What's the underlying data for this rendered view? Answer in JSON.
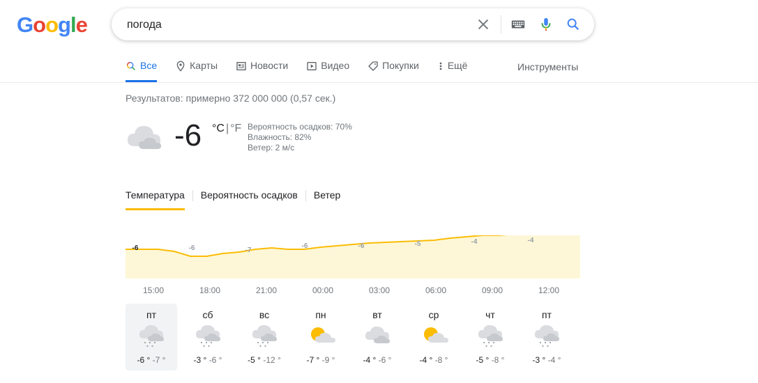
{
  "logo_text": [
    "G",
    "o",
    "o",
    "g",
    "l",
    "e"
  ],
  "logo_colors": [
    "#4285F4",
    "#EA4335",
    "#FBBC05",
    "#4285F4",
    "#34A853",
    "#EA4335"
  ],
  "search": {
    "query": "погода"
  },
  "tabs": [
    {
      "label": "Все",
      "icon": "search-icon",
      "active": true
    },
    {
      "label": "Карты",
      "icon": "map-pin-icon"
    },
    {
      "label": "Новости",
      "icon": "news-icon"
    },
    {
      "label": "Видео",
      "icon": "video-icon"
    },
    {
      "label": "Покупки",
      "icon": "tag-icon"
    },
    {
      "label": "Ещё",
      "icon": "more-vert-icon"
    }
  ],
  "tools_label": "Инструменты",
  "result_stats": "Результатов: примерно 372 000 000 (0,57 сек.)",
  "weather": {
    "current_icon": "cloudy-icon",
    "temp": "-6",
    "unit_c": "°C",
    "unit_sep": "|",
    "unit_f": "°F",
    "details": [
      "Вероятность осадков: 70%",
      "Влажность: 82%",
      "Ветер: 2 м/с"
    ],
    "chart_tabs": [
      "Температура",
      "Вероятность осадков",
      "Ветер"
    ],
    "hours": [
      "15:00",
      "18:00",
      "21:00",
      "00:00",
      "03:00",
      "06:00",
      "09:00",
      "12:00"
    ],
    "hour_labels": [
      "-6",
      "-6",
      "-7",
      "-6",
      "-6",
      "-5",
      "-4",
      "-4"
    ],
    "series_temps": [
      -6,
      -6,
      -6,
      -6.3,
      -7,
      -7,
      -6.6,
      -6.4,
      -6,
      -5.8,
      -6,
      -6,
      -5.7,
      -5.5,
      -5.3,
      -5.1,
      -5,
      -4.9,
      -4.8,
      -4.7,
      -4.4,
      -4.2,
      -4,
      -4,
      -3.8,
      -3.6,
      -3.3,
      -3.2,
      -3
    ],
    "days": [
      {
        "name": "пт",
        "high": "-6 °",
        "low": "-7 °",
        "icon": "snow-cloud-icon"
      },
      {
        "name": "сб",
        "high": "-3 °",
        "low": "-6 °",
        "icon": "snow-cloud-icon"
      },
      {
        "name": "вс",
        "high": "-5 °",
        "low": "-12 °",
        "icon": "snow-cloud-icon"
      },
      {
        "name": "пн",
        "high": "-7 °",
        "low": "-9 °",
        "icon": "partly-sunny-icon"
      },
      {
        "name": "вт",
        "high": "-4 °",
        "low": "-6 °",
        "icon": "cloudy-icon"
      },
      {
        "name": "ср",
        "high": "-4 °",
        "low": "-8 °",
        "icon": "partly-sunny-icon"
      },
      {
        "name": "чт",
        "high": "-5 °",
        "low": "-8 °",
        "icon": "snow-cloud-icon"
      },
      {
        "name": "пт",
        "high": "-3 °",
        "low": "-4 °",
        "icon": "snow-cloud-icon"
      }
    ]
  },
  "colors": {
    "accent_blue": "#1a73e8",
    "chart_line": "#fbbc04",
    "chart_fill": "#fef7d7",
    "muted": "#70757a"
  }
}
